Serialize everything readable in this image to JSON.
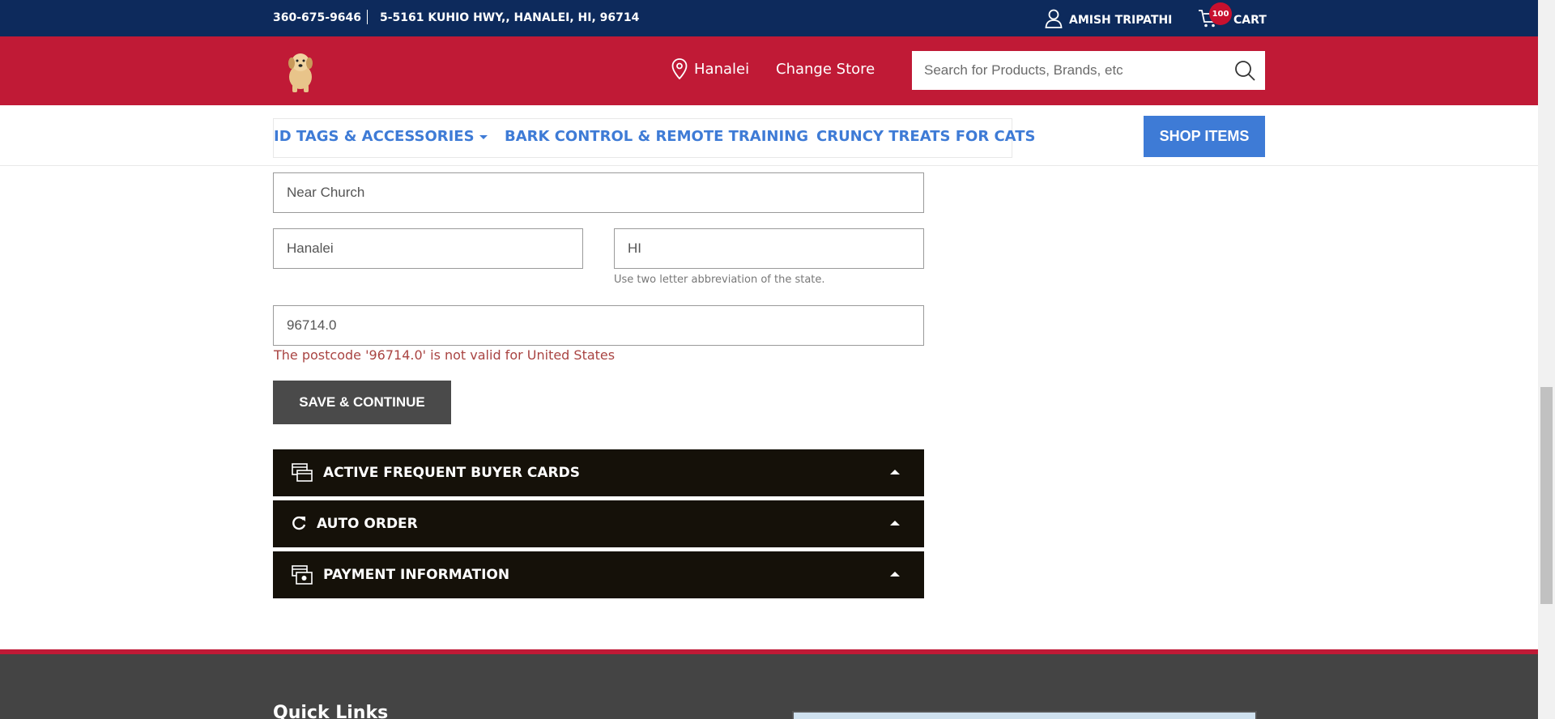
{
  "topbar": {
    "phone": "360-675-9646",
    "address": "5-5161 KUHIO HWY,, HANALEI, HI, 96714",
    "user_name": "AMISH TRIPATHI",
    "cart_count": "100",
    "cart_label": "CART"
  },
  "header": {
    "store_name": "Hanalei",
    "change_store": "Change Store",
    "search_placeholder": "Search for Products, Brands, etc"
  },
  "nav": {
    "items": [
      {
        "label": "ID TAGS & ACCESSORIES"
      },
      {
        "label": "BARK CONTROL & REMOTE TRAINING"
      },
      {
        "label": "CRUNCY TREATS FOR CATS"
      }
    ],
    "shop_button": "SHOP ITEMS"
  },
  "form": {
    "address2_value": "Near Church",
    "city_value": "Hanalei",
    "state_value": "HI",
    "state_hint": "Use two letter abbreviation of the state.",
    "postcode_value": "96714.0",
    "postcode_error": "The postcode '96714.0' is not valid for United States",
    "save_button": "SAVE & CONTINUE"
  },
  "panels": [
    {
      "label": "ACTIVE FREQUENT BUYER CARDS",
      "icon": "cards-icon"
    },
    {
      "label": "AUTO ORDER",
      "icon": "refresh-icon"
    },
    {
      "label": "PAYMENT INFORMATION",
      "icon": "payment-icon"
    }
  ],
  "footer": {
    "quick_links": "Quick Links"
  },
  "colors": {
    "topbar": "#0d2a5c",
    "header": "#c01a36",
    "nav_link": "#3e7bd6",
    "panel": "#151109",
    "error": "#a94442"
  }
}
